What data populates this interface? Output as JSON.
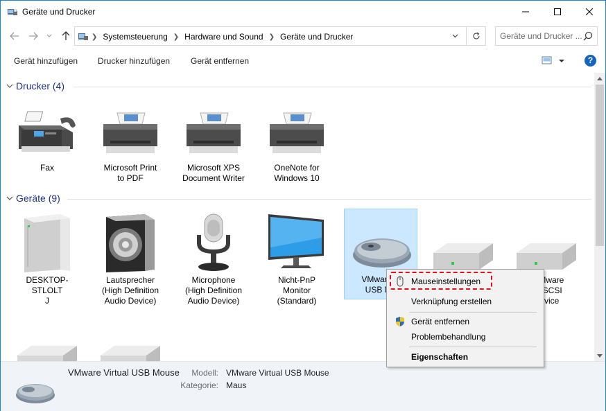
{
  "window": {
    "title": "Geräte und Drucker"
  },
  "address": {
    "crumbs": [
      "Systemsteuerung",
      "Hardware und Sound",
      "Geräte und Drucker"
    ],
    "search_placeholder": "Geräte und Drucker ..."
  },
  "commands": {
    "add_device": "Gerät hinzufügen",
    "add_printer": "Drucker hinzufügen",
    "remove_device": "Gerät entfernen",
    "help": "?"
  },
  "groups": {
    "printers": {
      "title": "Drucker (4)",
      "items": [
        {
          "label": "Fax",
          "icon": "fax-icon"
        },
        {
          "label": "Microsoft Print\nto PDF",
          "icon": "printer-icon"
        },
        {
          "label": "Microsoft XPS\nDocument Writer",
          "icon": "printer-icon"
        },
        {
          "label": "OneNote for\nWindows 10",
          "icon": "printer-icon"
        }
      ]
    },
    "devices": {
      "title": "Geräte (9)",
      "items": [
        {
          "label": "DESKTOP-STLOLT\nJ",
          "icon": "computer-tower-icon"
        },
        {
          "label": "Lautsprecher\n(High Definition\nAudio Device)",
          "icon": "speaker-icon"
        },
        {
          "label": "Microphone\n(High Definition\nAudio Device)",
          "icon": "microphone-icon"
        },
        {
          "label": "Nicht-PnP\nMonitor\n(Standard)",
          "icon": "monitor-icon"
        },
        {
          "label": "VMware V\nUSB Mo",
          "icon": "mouse-icon"
        },
        {
          "label": "",
          "icon": "drive-icon"
        },
        {
          "label": ", VMware\nl S SCSI\nDevice",
          "icon": "drive-icon"
        }
      ]
    }
  },
  "details": {
    "name": "VMware Virtual USB Mouse",
    "model_label": "Modell:",
    "model_value": "VMware Virtual USB Mouse",
    "category_label": "Kategorie:",
    "category_value": "Maus"
  },
  "context_menu": {
    "items": [
      "Mauseinstellungen",
      "Verknüpfung erstellen",
      "Gerät entfernen",
      "Problembehandlung",
      "Eigenschaften"
    ]
  },
  "colors": {
    "accent": "#1883d7",
    "group_title": "#1e3287",
    "selection": "#cce8ff",
    "highlight_border": "#e0101c"
  }
}
